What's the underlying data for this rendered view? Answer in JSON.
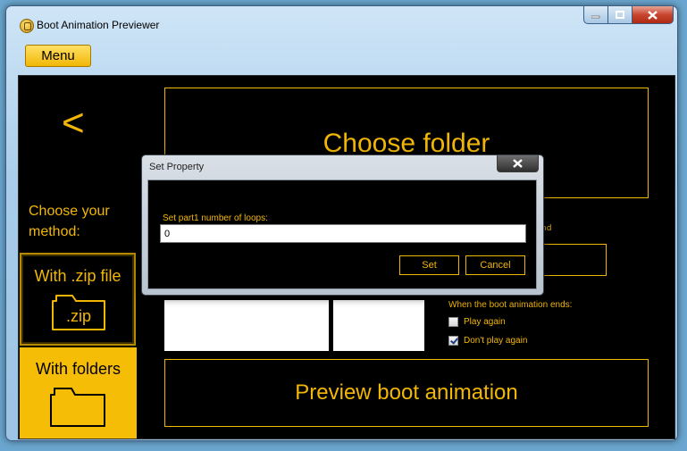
{
  "window": {
    "title": "Boot Animation Previewer",
    "menu_label": "Menu"
  },
  "main": {
    "back_glyph": "<",
    "choose_method": "Choose your method:",
    "method_zip": {
      "label": "With .zip file",
      "icon_text": ".zip"
    },
    "method_folders": {
      "label": "With folders"
    },
    "choose_folder_label": "Choose folder",
    "partial_label": "nd",
    "ends_label": "When the boot animation ends:",
    "options": [
      {
        "label": "Play again",
        "checked": false
      },
      {
        "label": "Don't play again",
        "checked": true
      }
    ],
    "preview_label": "Preview boot animation"
  },
  "dialog": {
    "title": "Set Property",
    "prompt": "Set part1 number of loops:",
    "input_value": "0",
    "set_label": "Set",
    "cancel_label": "Cancel"
  },
  "colors": {
    "accent": "#f2b705",
    "background": "#000000"
  }
}
